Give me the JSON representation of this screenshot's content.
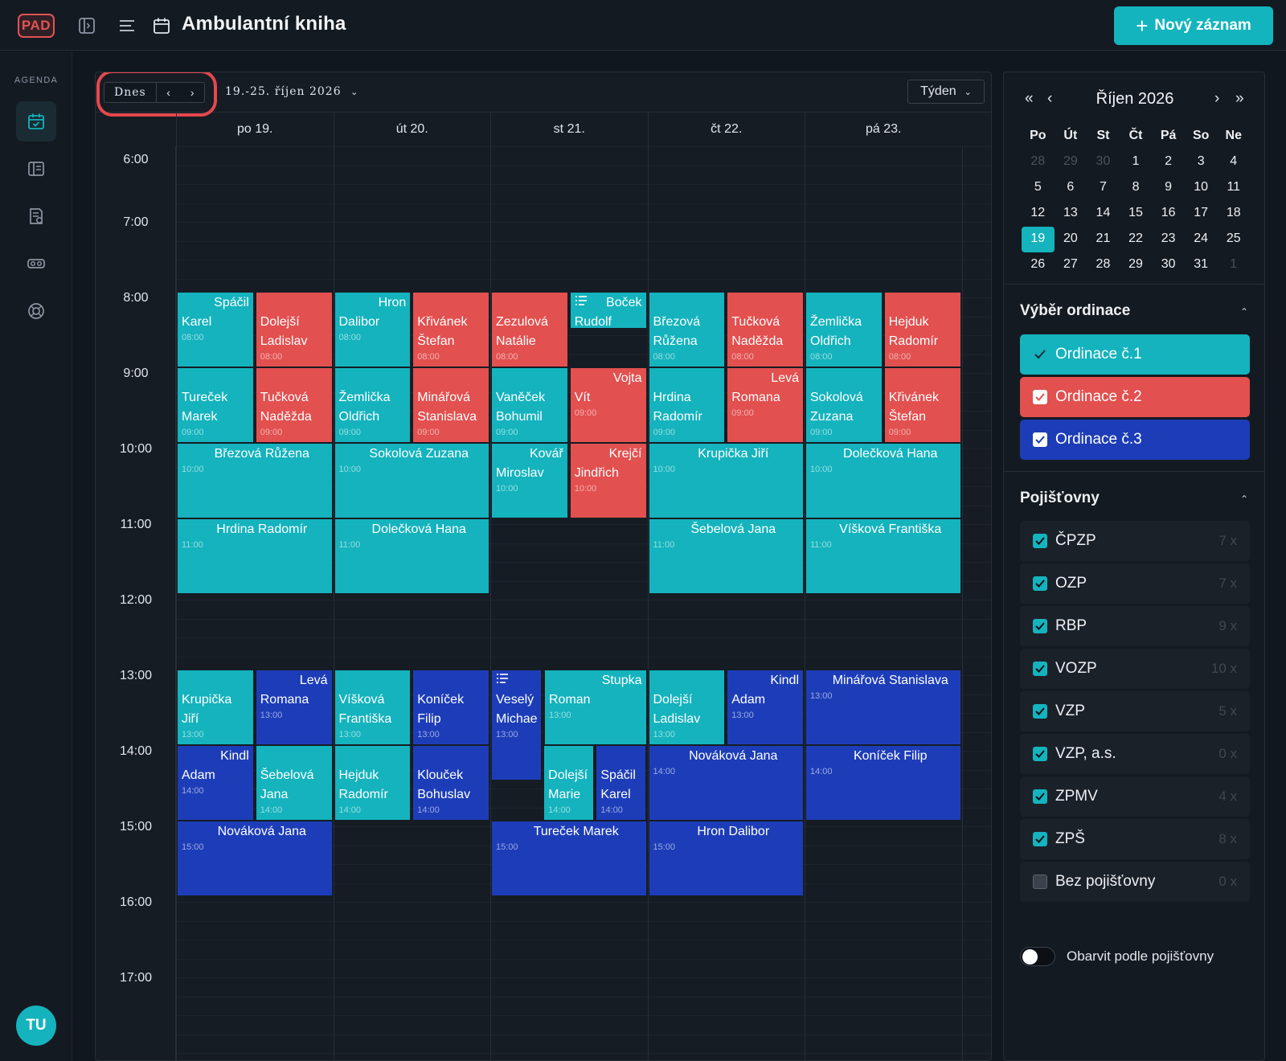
{
  "app": {
    "logo": "PAD",
    "title": "Ambulantní kniha",
    "new_record": "Nový záznam",
    "icons": [
      "sidebar-toggle-icon",
      "menu-lines-icon",
      "calendar-icon",
      "plus-icon"
    ]
  },
  "sidebar": {
    "section_label": "AGENDA",
    "items": [
      {
        "icon": "calendar-check-icon",
        "active": true
      },
      {
        "icon": "book-icon",
        "active": false
      },
      {
        "icon": "document-check-icon",
        "active": false
      },
      {
        "icon": "vr-glasses-icon",
        "active": false
      },
      {
        "icon": "lifebuoy-icon",
        "active": false
      }
    ],
    "avatar": "TU"
  },
  "toolbar": {
    "today": "Dnes",
    "prev": "‹",
    "next": "›",
    "range": "19.-25. říjen 2026",
    "view": "Týden"
  },
  "calendar": {
    "days": [
      "po 19.",
      "út 20.",
      "st 21.",
      "čt 22.",
      "pá 23."
    ],
    "hours": [
      "6:00",
      "7:00",
      "8:00",
      "9:00",
      "10:00",
      "11:00",
      "12:00",
      "13:00",
      "14:00",
      "15:00",
      "16:00",
      "17:00"
    ],
    "colors": {
      "ordinace_1": "#14b3bd",
      "ordinace_2": "#e2504f",
      "ordinace_3": "#1d3db8"
    },
    "events": [
      {
        "day": 0,
        "slot": 0,
        "span": 2,
        "ord": 1,
        "title": "Spáčil",
        "sub": "Karel",
        "time": "08:00",
        "align": "right"
      },
      {
        "day": 0,
        "slot": 1,
        "span": 2,
        "ord": 2,
        "title": "",
        "sub": "Dolejší Ladislav",
        "time": "08:00",
        "align": "left"
      },
      {
        "day": 1,
        "slot": 0,
        "span": 2,
        "ord": 1,
        "title": "Hron",
        "sub": "Dalibor",
        "time": "08:00",
        "align": "right"
      },
      {
        "day": 1,
        "slot": 1,
        "span": 2,
        "ord": 2,
        "title": "",
        "sub": "Křivánek Štefan",
        "time": "08:00",
        "align": "left"
      },
      {
        "day": 2,
        "slot": 0,
        "span": 2,
        "ord": 2,
        "title": "",
        "sub": "Zezulová Natálie",
        "time": "08:00",
        "align": "left"
      },
      {
        "day": 2,
        "slot": 1,
        "span": 2,
        "ord": 1,
        "title": "Boček",
        "sub": "Rudolf",
        "time": "",
        "align": "right",
        "list": true,
        "short": true
      },
      {
        "day": 3,
        "slot": 0,
        "span": 2,
        "ord": 1,
        "title": "",
        "sub": "Březová Růžena",
        "time": "08:00",
        "align": "left"
      },
      {
        "day": 3,
        "slot": 1,
        "span": 2,
        "ord": 2,
        "title": "",
        "sub": "Tučková Naděžda",
        "time": "08:00",
        "align": "left"
      },
      {
        "day": 4,
        "slot": 0,
        "span": 2,
        "ord": 1,
        "title": "",
        "sub": "Žemlička Oldřich",
        "time": "08:00",
        "align": "left"
      },
      {
        "day": 4,
        "slot": 1,
        "span": 2,
        "ord": 2,
        "title": "",
        "sub": "Hejduk Radomír",
        "time": "08:00",
        "align": "left"
      },
      {
        "day": 0,
        "slot": 0,
        "span": 2,
        "ord": 1,
        "row": 1,
        "title": "",
        "sub": "Tureček Marek",
        "time": "09:00",
        "align": "left"
      },
      {
        "day": 0,
        "slot": 1,
        "span": 2,
        "ord": 2,
        "row": 1,
        "title": "",
        "sub": "Tučková Naděžda",
        "time": "09:00",
        "align": "left"
      },
      {
        "day": 1,
        "slot": 0,
        "span": 2,
        "ord": 1,
        "row": 1,
        "title": "",
        "sub": "Žemlička Oldřich",
        "time": "09:00",
        "align": "left"
      },
      {
        "day": 1,
        "slot": 1,
        "span": 2,
        "ord": 2,
        "row": 1,
        "title": "",
        "sub": "Minářová Stanislava",
        "time": "09:00",
        "align": "left"
      },
      {
        "day": 2,
        "slot": 0,
        "span": 2,
        "ord": 1,
        "row": 1,
        "title": "",
        "sub": "Vaněček Bohumil",
        "time": "09:00",
        "align": "left"
      },
      {
        "day": 2,
        "slot": 1,
        "span": 2,
        "ord": 2,
        "row": 1,
        "title": "Vojta",
        "sub": "Vít",
        "time": "09:00",
        "align": "right"
      },
      {
        "day": 3,
        "slot": 0,
        "span": 2,
        "ord": 1,
        "row": 1,
        "title": "",
        "sub": "Hrdina Radomír",
        "time": "09:00",
        "align": "left"
      },
      {
        "day": 3,
        "slot": 1,
        "span": 2,
        "ord": 2,
        "row": 1,
        "title": "Levá",
        "sub": "Romana",
        "time": "09:00",
        "align": "right"
      },
      {
        "day": 4,
        "slot": 0,
        "span": 2,
        "ord": 1,
        "row": 1,
        "title": "",
        "sub": "Sokolová Zuzana",
        "time": "09:00",
        "align": "left"
      },
      {
        "day": 4,
        "slot": 1,
        "span": 2,
        "ord": 2,
        "row": 1,
        "title": "",
        "sub": "Křivánek Štefan",
        "time": "09:00",
        "align": "left"
      },
      {
        "day": 0,
        "slot": 0,
        "span": 1,
        "ord": 1,
        "row": 2,
        "title": "Březová Růžena",
        "sub": "",
        "time": "10:00",
        "align": "center"
      },
      {
        "day": 1,
        "slot": 0,
        "span": 1,
        "ord": 1,
        "row": 2,
        "title": "Sokolová Zuzana",
        "sub": "",
        "time": "10:00",
        "align": "center"
      },
      {
        "day": 2,
        "slot": 0,
        "span": 2,
        "ord": 1,
        "row": 2,
        "title": "Kovář",
        "sub": "Miroslav",
        "time": "10:00",
        "align": "right"
      },
      {
        "day": 2,
        "slot": 1,
        "span": 2,
        "ord": 2,
        "row": 2,
        "title": "Krejčí",
        "sub": "Jindřich",
        "time": "10:00",
        "align": "right"
      },
      {
        "day": 3,
        "slot": 0,
        "span": 1,
        "ord": 1,
        "row": 2,
        "title": "Krupička Jiří",
        "sub": "",
        "time": "10:00",
        "align": "center"
      },
      {
        "day": 4,
        "slot": 0,
        "span": 1,
        "ord": 1,
        "row": 2,
        "title": "Dolečková Hana",
        "sub": "",
        "time": "10:00",
        "align": "center"
      },
      {
        "day": 0,
        "slot": 0,
        "span": 1,
        "ord": 1,
        "row": 3,
        "title": "Hrdina Radomír",
        "sub": "",
        "time": "11:00",
        "align": "center"
      },
      {
        "day": 1,
        "slot": 0,
        "span": 1,
        "ord": 1,
        "row": 3,
        "title": "Dolečková Hana",
        "sub": "",
        "time": "11:00",
        "align": "center"
      },
      {
        "day": 3,
        "slot": 0,
        "span": 1,
        "ord": 1,
        "row": 3,
        "title": "Šebelová Jana",
        "sub": "",
        "time": "11:00",
        "align": "center"
      },
      {
        "day": 4,
        "slot": 0,
        "span": 1,
        "ord": 1,
        "row": 3,
        "title": "Víšková Františka",
        "sub": "",
        "time": "11:00",
        "align": "center"
      },
      {
        "day": 0,
        "slot": 0,
        "span": 2,
        "ord": 1,
        "row": 5,
        "title": "",
        "sub": "Krupička Jiří",
        "time": "13:00",
        "align": "left"
      },
      {
        "day": 0,
        "slot": 1,
        "span": 2,
        "ord": 3,
        "row": 5,
        "title": "Levá",
        "sub": "Romana",
        "time": "13:00",
        "align": "right"
      },
      {
        "day": 1,
        "slot": 0,
        "span": 2,
        "ord": 1,
        "row": 5,
        "title": "",
        "sub": "Víšková Františka",
        "time": "13:00",
        "align": "left"
      },
      {
        "day": 1,
        "slot": 1,
        "span": 2,
        "ord": 3,
        "row": 5,
        "title": "",
        "sub": "Koníček Filip",
        "time": "13:00",
        "align": "left"
      },
      {
        "day": 2,
        "slot": 0,
        "span": 3,
        "ord": 3,
        "row": 5,
        "title": "",
        "sub": "Veselý Michae",
        "time": "13:00",
        "align": "left",
        "list": true
      },
      {
        "day": 2,
        "slot": 1,
        "span": 1.5,
        "ord": 1,
        "row": 5,
        "title": "Stupka",
        "sub": "Roman",
        "time": "13:00",
        "align": "right"
      },
      {
        "day": 3,
        "slot": 0,
        "span": 2,
        "ord": 1,
        "row": 5,
        "title": "",
        "sub": "Dolejší Ladislav",
        "time": "13:00",
        "align": "left"
      },
      {
        "day": 3,
        "slot": 1,
        "span": 2,
        "ord": 3,
        "row": 5,
        "title": "Kindl",
        "sub": "Adam",
        "time": "13:00",
        "align": "right"
      },
      {
        "day": 4,
        "slot": 0,
        "span": 1,
        "ord": 3,
        "row": 5,
        "title": "Minářová Stanislava",
        "sub": "",
        "time": "13:00",
        "align": "center"
      },
      {
        "day": 0,
        "slot": 0,
        "span": 2,
        "ord": 3,
        "row": 6,
        "title": "Kindl",
        "sub": "Adam",
        "time": "14:00",
        "align": "right"
      },
      {
        "day": 0,
        "slot": 1,
        "span": 2,
        "ord": 1,
        "row": 6,
        "title": "",
        "sub": "Šebelová Jana",
        "time": "14:00",
        "align": "left"
      },
      {
        "day": 1,
        "slot": 0,
        "span": 2,
        "ord": 1,
        "row": 6,
        "title": "",
        "sub": "Hejduk Radomír",
        "time": "14:00",
        "align": "left"
      },
      {
        "day": 1,
        "slot": 1,
        "span": 2,
        "ord": 3,
        "row": 6,
        "title": "",
        "sub": "Klouček Bohuslav",
        "time": "14:00",
        "align": "left"
      },
      {
        "day": 2,
        "slot": 1,
        "span": 3,
        "ord": 1,
        "row": 6,
        "title": "",
        "sub": "Dolejší Marie",
        "time": "14:00",
        "align": "left"
      },
      {
        "day": 2,
        "slot": 2,
        "span": 3,
        "ord": 3,
        "row": 6,
        "title": "",
        "sub": "Spáčil Karel",
        "time": "14:00",
        "align": "left"
      },
      {
        "day": 3,
        "slot": 0,
        "span": 1,
        "ord": 3,
        "row": 6,
        "title": "Nováková Jana",
        "sub": "",
        "time": "14:00",
        "align": "center"
      },
      {
        "day": 4,
        "slot": 0,
        "span": 1,
        "ord": 3,
        "row": 6,
        "title": "Koníček Filip",
        "sub": "",
        "time": "14:00",
        "align": "center"
      },
      {
        "day": 0,
        "slot": 0,
        "span": 1,
        "ord": 3,
        "row": 7,
        "title": "Nováková Jana",
        "sub": "",
        "time": "15:00",
        "align": "center"
      },
      {
        "day": 2,
        "slot": 0,
        "span": 1,
        "ord": 3,
        "row": 7,
        "title": "Tureček Marek",
        "sub": "",
        "time": "15:00",
        "align": "center"
      },
      {
        "day": 3,
        "slot": 0,
        "span": 1,
        "ord": 3,
        "row": 7,
        "title": "Hron Dalibor",
        "sub": "",
        "time": "15:00",
        "align": "center"
      }
    ]
  },
  "minical": {
    "title": "Říjen 2026",
    "first": "«",
    "prev": "‹",
    "next": "›",
    "last": "»",
    "weekdays": [
      "Po",
      "Út",
      "St",
      "Čt",
      "Pá",
      "So",
      "Ne"
    ],
    "weeks": [
      [
        {
          "d": "28",
          "m": true
        },
        {
          "d": "29",
          "m": true
        },
        {
          "d": "30",
          "m": true
        },
        {
          "d": "1"
        },
        {
          "d": "2"
        },
        {
          "d": "3"
        },
        {
          "d": "4"
        }
      ],
      [
        {
          "d": "5"
        },
        {
          "d": "6"
        },
        {
          "d": "7"
        },
        {
          "d": "8"
        },
        {
          "d": "9"
        },
        {
          "d": "10"
        },
        {
          "d": "11"
        }
      ],
      [
        {
          "d": "12"
        },
        {
          "d": "13"
        },
        {
          "d": "14"
        },
        {
          "d": "15"
        },
        {
          "d": "16"
        },
        {
          "d": "17"
        },
        {
          "d": "18"
        }
      ],
      [
        {
          "d": "19",
          "s": true
        },
        {
          "d": "20"
        },
        {
          "d": "21"
        },
        {
          "d": "22"
        },
        {
          "d": "23"
        },
        {
          "d": "24"
        },
        {
          "d": "25"
        }
      ],
      [
        {
          "d": "26"
        },
        {
          "d": "27"
        },
        {
          "d": "28"
        },
        {
          "d": "29"
        },
        {
          "d": "30"
        },
        {
          "d": "31"
        },
        {
          "d": "1",
          "m": true
        }
      ]
    ]
  },
  "ordinace": {
    "title": "Výběr ordinace",
    "items": [
      {
        "label": "Ordinace č.1",
        "checked": true
      },
      {
        "label": "Ordinace č.2",
        "checked": true
      },
      {
        "label": "Ordinace č.3",
        "checked": true
      }
    ]
  },
  "insurers": {
    "title": "Pojišťovny",
    "items": [
      {
        "label": "ČPZP",
        "count": "7 x",
        "checked": true
      },
      {
        "label": "OZP",
        "count": "7 x",
        "checked": true
      },
      {
        "label": "RBP",
        "count": "9 x",
        "checked": true
      },
      {
        "label": "VOZP",
        "count": "10 x",
        "checked": true
      },
      {
        "label": "VZP",
        "count": "5 x",
        "checked": true
      },
      {
        "label": "VZP, a.s.",
        "count": "0 x",
        "checked": true
      },
      {
        "label": "ZPMV",
        "count": "4 x",
        "checked": true
      },
      {
        "label": "ZPŠ",
        "count": "8 x",
        "checked": true
      },
      {
        "label": "Bez pojišťovny",
        "count": "0 x",
        "checked": false
      }
    ],
    "toggle_label": "Obarvit podle pojišťovny",
    "toggle_on": false
  }
}
